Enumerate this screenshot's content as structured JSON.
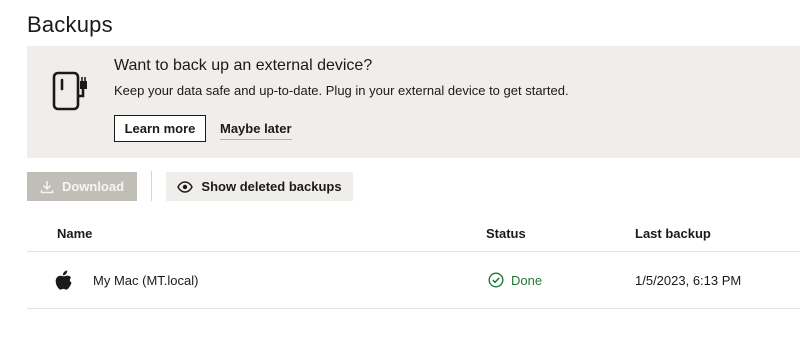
{
  "page": {
    "title": "Backups"
  },
  "banner": {
    "icon": "external-device-icon",
    "title": "Want to back up an external device?",
    "description": "Keep your data safe and up-to-date. Plug in your external device to get started.",
    "learn_more_label": "Learn more",
    "maybe_later_label": "Maybe later"
  },
  "toolbar": {
    "download_label": "Download",
    "download_icon": "download-icon",
    "show_deleted_label": "Show deleted backups",
    "show_deleted_icon": "eye-icon"
  },
  "table": {
    "columns": [
      "Name",
      "Status",
      "Last backup"
    ],
    "rows": [
      {
        "icon": "apple-icon",
        "name": "My Mac (MT.local)",
        "status": "Done",
        "status_icon": "check-circle-icon",
        "last_backup": "1/5/2023, 6:13 PM"
      }
    ]
  },
  "colors": {
    "text": "#1e1919",
    "banner_bg": "#f0eeeb",
    "disabled_button_bg": "#c1bdb7",
    "success": "#1d7a3a"
  }
}
